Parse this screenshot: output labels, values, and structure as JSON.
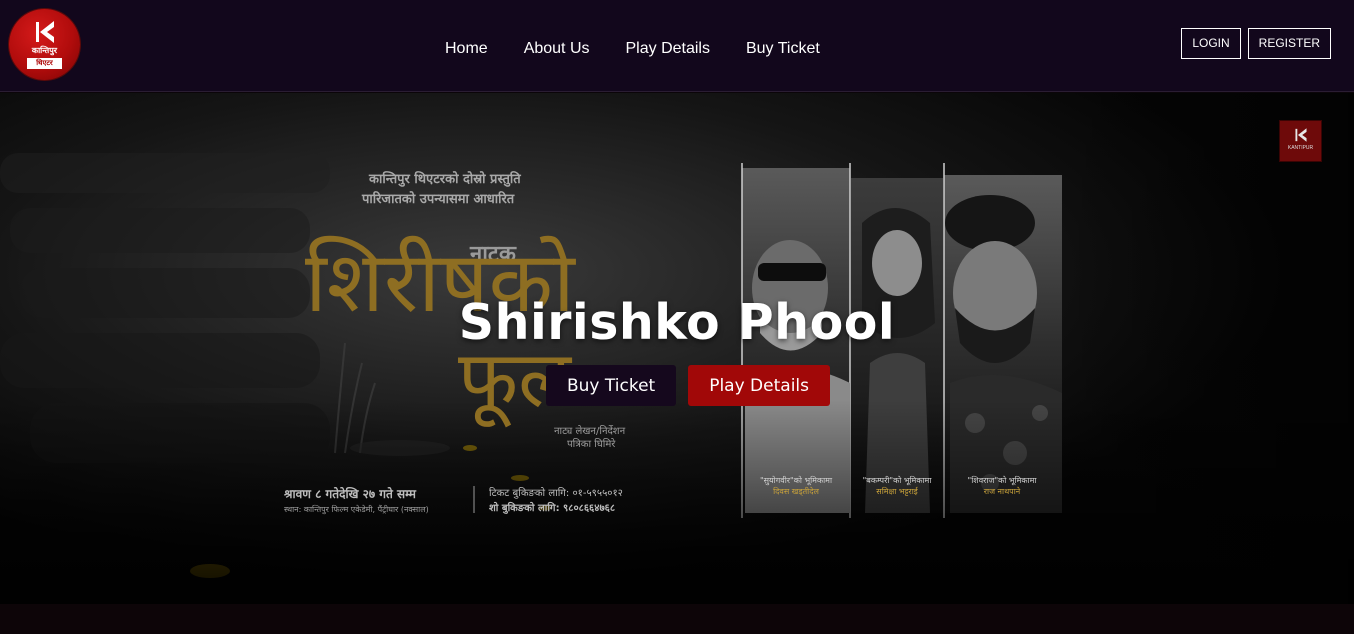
{
  "header": {
    "logo": {
      "icon": "kantipur-k-icon",
      "text": "कान्तिपुर",
      "sub": "थिएटर"
    },
    "nav": [
      {
        "label": "Home"
      },
      {
        "label": "About Us"
      },
      {
        "label": "Play Details"
      },
      {
        "label": "Buy Ticket"
      }
    ],
    "login_label": "LOGIN",
    "register_label": "REGISTER"
  },
  "hero": {
    "title": "Shirishko Phool",
    "buy_label": "Buy Ticket",
    "play_label": "Play Details",
    "poster": {
      "line1": "कान्तिपुर थिएटरको दोस्रो प्रस्तुति",
      "line2": "पारिजातको उपन्यासमा आधारित",
      "natak": "नाटक",
      "title_line1": "शिरीषको",
      "title_line2": "फूल",
      "director_role": "नाट्य लेखन/निर्देशन",
      "director_name": "पत्रिका घिमिरे",
      "dates": "श्रावण ८ गतेदेखि २७ गते सम्म",
      "venue": "स्थान: कान्तिपुर फिल्म एकेडेमी, पैंट्रीघार (नक्साल)",
      "ticket_booking": "टिकट बुकिङको लागि: ०१-५९५५०१२",
      "show_booking": "शो बुकिङको लागि: ९८०८६६४७६८",
      "cast": [
        {
          "caption": "\"सुयोगवीर\"को भूमिकामा",
          "name": "दिवस खड्तीदेल"
        },
        {
          "caption": "\"बकम्परी\"को भूमिकामा",
          "name": "समिक्षा भट्टराई"
        },
        {
          "caption": "\"शिवराज\"को भूमिकामा",
          "name": "राज नाथपाने"
        }
      ]
    },
    "badge_text": "KANTIPUR"
  },
  "colors": {
    "nav_bg": "#12071c",
    "accent_red": "#a10808",
    "dark_button": "#15081d",
    "gold": "#8e6e22"
  }
}
